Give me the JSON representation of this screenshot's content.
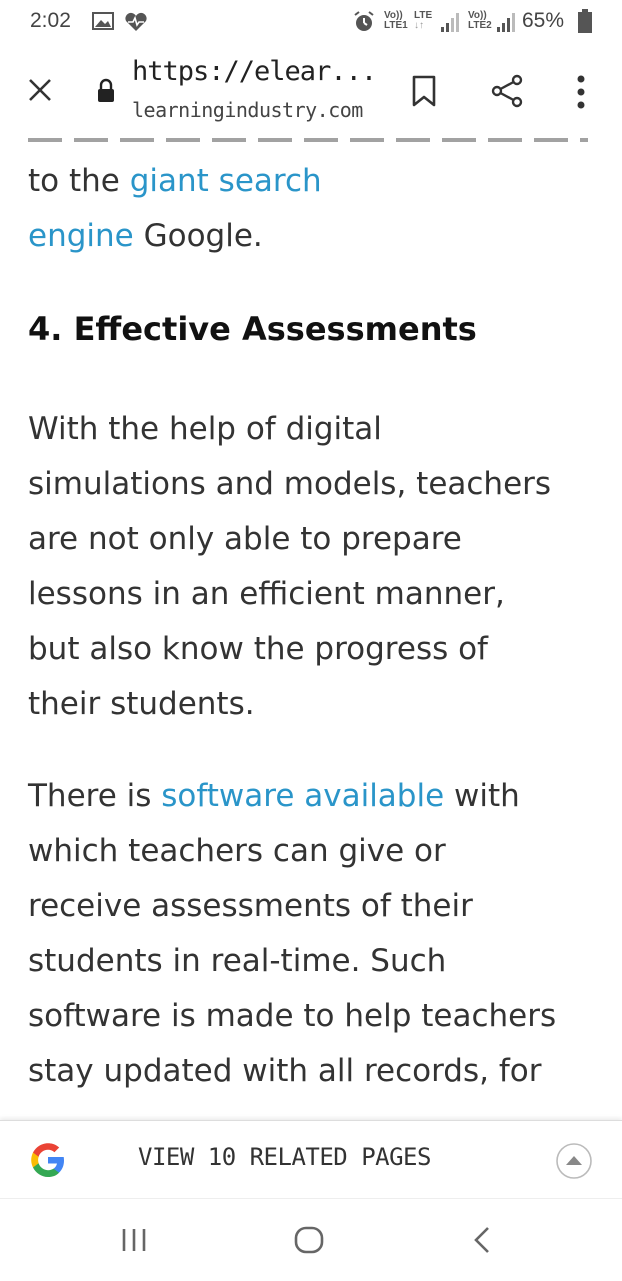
{
  "status_bar": {
    "time": "2:02",
    "battery": "65%",
    "sim1_top": "Vo))",
    "sim1_lte_top": "LTE",
    "sim1_bottom": "LTE1",
    "sim1_arrows": "↓↑",
    "sim2_top": "Vo))",
    "sim2_bottom": "LTE2"
  },
  "browser": {
    "url_text": "https://elear...",
    "domain": "learningindustry.com"
  },
  "article": {
    "p1_pre": "to the ",
    "p1_link_line1": "giant search",
    "p1_link_line2": "engine",
    "p1_post": " Google.",
    "heading": "4. Effective Assessments",
    "p2_lines": [
      "With the help of digital",
      "simulations and models, teachers",
      "are not only able to prepare",
      "lessons in an efficient manner,",
      "but also know the progress of",
      "their students."
    ],
    "p3_line1_pre": "There is ",
    "p3_line1_link": "software available",
    "p3_line1_post": " with",
    "p3_lines": [
      "which teachers can give or",
      "receive assessments of their",
      "students in real-time. Such",
      "software is made to help teachers",
      "stay updated with all records, for"
    ]
  },
  "related_bar": {
    "label": "VIEW 10 RELATED PAGES"
  },
  "colors": {
    "link": "#2a95c9",
    "google_blue": "#4285F4",
    "google_red": "#EA4335",
    "google_yellow": "#FBBC05",
    "google_green": "#34A853"
  }
}
